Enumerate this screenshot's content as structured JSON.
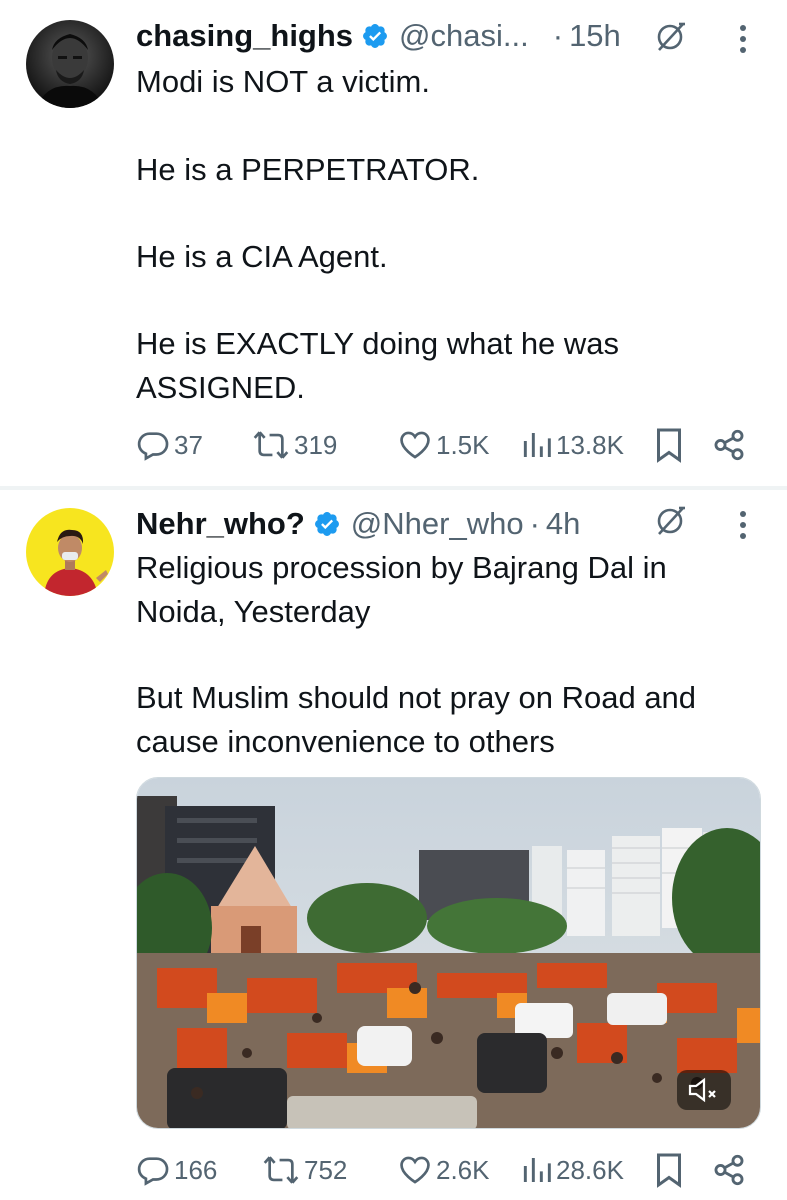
{
  "tweets": [
    {
      "display_name": "chasing_highs",
      "handle": "@chasi...",
      "separator": "·",
      "time": "15h",
      "body_lines": [
        "Modi is NOT a victim.",
        "He is a PERPETRATOR.",
        "He is a CIA Agent.",
        "He is EXACTLY doing what he was",
        "ASSIGNED."
      ],
      "replies": "37",
      "reposts": "319",
      "likes": "1.5K",
      "views": "13.8K"
    },
    {
      "display_name": "Nehr_who?",
      "handle": "@Nher_who",
      "separator": "·",
      "time": "4h",
      "body_lines": [
        "Religious procession by Bajrang Dal in",
        "Noida, Yesterday",
        "But Muslim should not pray on Road and",
        "cause inconvenience to others"
      ],
      "replies": "166",
      "reposts": "752",
      "likes": "2.6K",
      "views": "28.6K"
    }
  ],
  "icons": {
    "verified": "verified-badge-icon",
    "grok": "grok-icon",
    "more": "more-icon",
    "reply": "reply-icon",
    "repost": "repost-icon",
    "like": "like-icon",
    "views": "views-icon",
    "bookmark": "bookmark-icon",
    "share": "share-icon",
    "mute": "mute-icon"
  },
  "colors": {
    "verified": "#1d9bf0",
    "text": "#0f1419",
    "secondary": "#536471"
  }
}
